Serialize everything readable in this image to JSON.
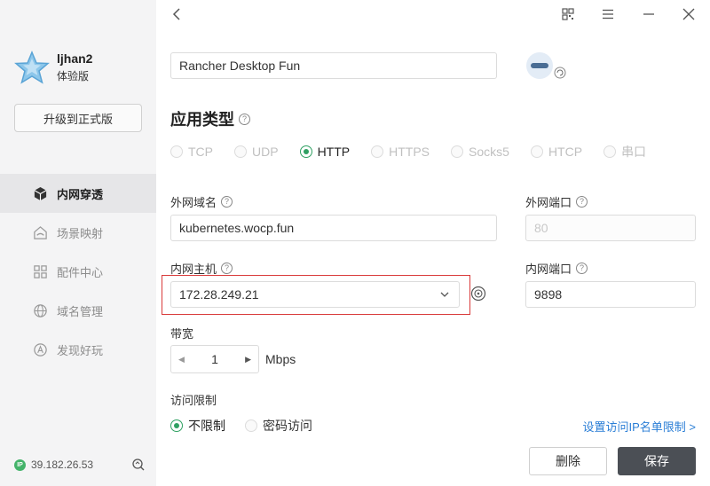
{
  "sidebar": {
    "username": "ljhan2",
    "edition": "体验版",
    "upgrade_label": "升级到正式版",
    "items": [
      {
        "label": "内网穿透",
        "icon": "cube-icon",
        "active": true
      },
      {
        "label": "场景映射",
        "icon": "house-icon",
        "active": false
      },
      {
        "label": "配件中心",
        "icon": "grid-icon",
        "active": false
      },
      {
        "label": "域名管理",
        "icon": "globe-icon",
        "active": false
      },
      {
        "label": "发现好玩",
        "icon": "compass-icon",
        "active": false
      }
    ],
    "footer_ip_badge": "IP",
    "footer_ip": "39.182.26.53"
  },
  "form": {
    "app_name": "Rancher Desktop Fun",
    "app_type_title": "应用类型",
    "protocols": [
      {
        "label": "TCP",
        "checked": false
      },
      {
        "label": "UDP",
        "checked": false
      },
      {
        "label": "HTTP",
        "checked": true
      },
      {
        "label": "HTTPS",
        "checked": false
      },
      {
        "label": "Socks5",
        "checked": false
      },
      {
        "label": "HTCP",
        "checked": false
      },
      {
        "label": "串口",
        "checked": false
      }
    ],
    "external_domain_label": "外网域名",
    "external_domain_value": "kubernetes.wocp.fun",
    "external_port_label": "外网端口",
    "external_port_value": "80",
    "internal_host_label": "内网主机",
    "internal_host_value": "172.28.249.21",
    "internal_port_label": "内网端口",
    "internal_port_value": "9898",
    "bandwidth_label": "带宽",
    "bandwidth_value": "1",
    "bandwidth_unit": "Mbps",
    "access_limit_label": "访问限制",
    "access_options": [
      {
        "label": "不限制",
        "checked": true
      },
      {
        "label": "密码访问",
        "checked": false
      }
    ],
    "ip_list_link": "设置访问IP名单限制 >",
    "help_glyph": "?"
  },
  "actions": {
    "delete_label": "删除",
    "save_label": "保存"
  },
  "colors": {
    "accent_green": "#2fa062",
    "save_button": "#4b4f55",
    "link_blue": "#2a7ed6",
    "highlight_red": "#d93a3a"
  }
}
